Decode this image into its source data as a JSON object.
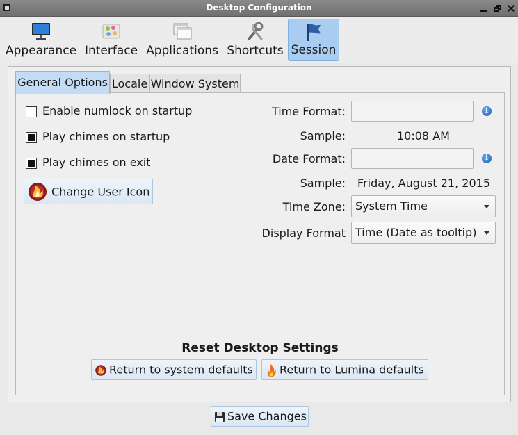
{
  "window": {
    "title": "Desktop Configuration"
  },
  "toolbar": {
    "items": [
      {
        "label": "Appearance",
        "icon": "monitor-icon"
      },
      {
        "label": "Interface",
        "icon": "palette-icon"
      },
      {
        "label": "Applications",
        "icon": "windows-icon"
      },
      {
        "label": "Shortcuts",
        "icon": "tools-icon"
      },
      {
        "label": "Session",
        "icon": "flag-icon",
        "active": true
      }
    ]
  },
  "tabs": {
    "items": [
      {
        "label": "General Options",
        "active": true
      },
      {
        "label": "Locale"
      },
      {
        "label": "Window System"
      }
    ]
  },
  "general": {
    "numlock_label": "Enable numlock on startup",
    "numlock_checked": false,
    "chimes_startup_label": "Play chimes on startup",
    "chimes_startup_checked": true,
    "chimes_exit_label": "Play chimes on exit",
    "chimes_exit_checked": true,
    "change_icon_label": "Change User Icon",
    "time_format_label": "Time Format:",
    "time_format_value": "",
    "sample_label": "Sample:",
    "time_sample": "10:08 AM",
    "date_format_label": "Date Format:",
    "date_format_value": "",
    "date_sample": "Friday, August 21, 2015",
    "time_zone_label": "Time Zone:",
    "time_zone_value": "System Time",
    "display_format_label": "Display Format",
    "display_format_value": "Time (Date as tooltip)",
    "reset_title": "Reset Desktop Settings",
    "return_system_label": "Return to system defaults",
    "return_lumina_label": "Return to Lumina defaults"
  },
  "footer": {
    "save_label": "Save Changes"
  },
  "colors": {
    "accent": "#a8cdf0",
    "tab_active": "#c3dcf4",
    "titlebar": "#7a7a7a"
  }
}
